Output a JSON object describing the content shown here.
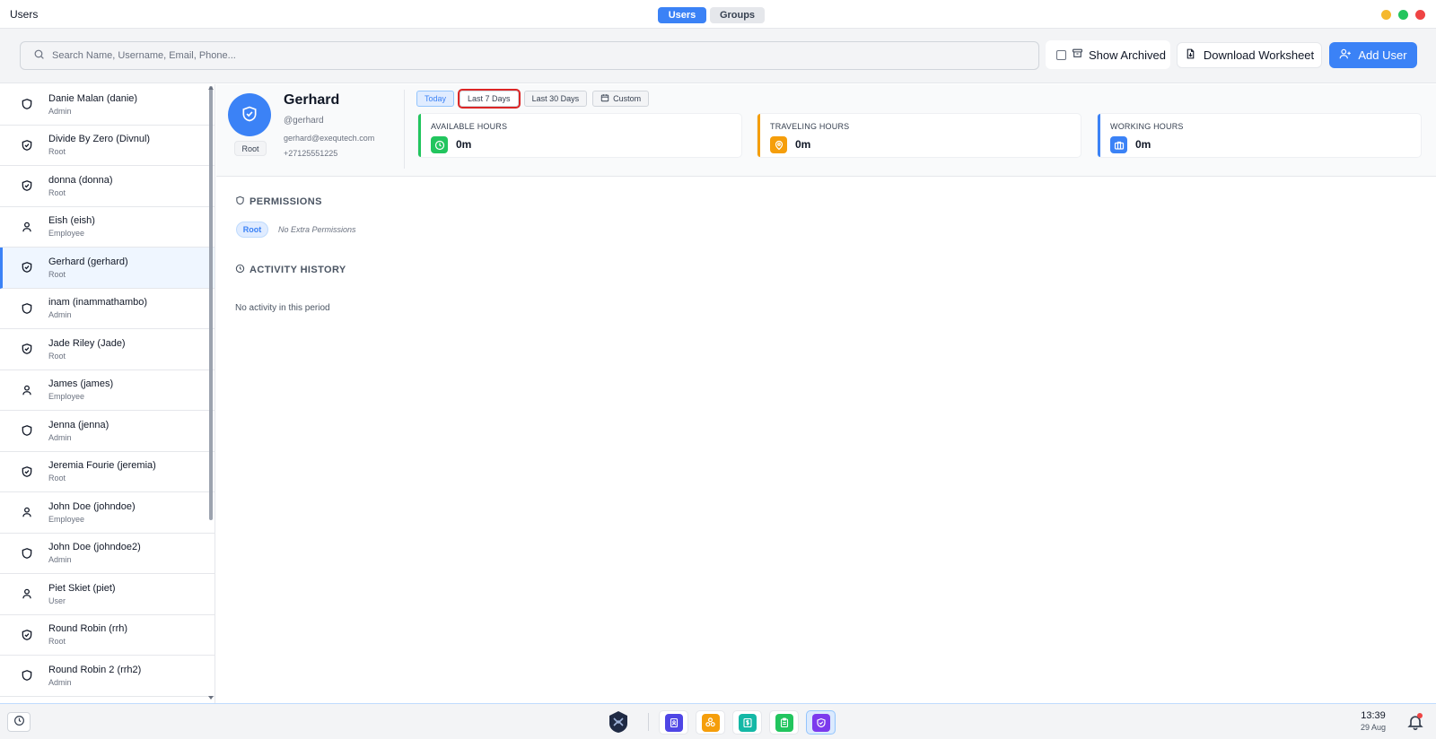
{
  "window": {
    "title": "Users"
  },
  "nav": {
    "users_label": "Users",
    "groups_label": "Groups"
  },
  "colors": {
    "accent": "#3b82f6",
    "available": "#22c55e",
    "traveling": "#f59e0b",
    "working": "#3b82f6",
    "selected_bg": "#eff6ff",
    "highlight_outline": "#dc2626"
  },
  "toolbar": {
    "search_placeholder": "Search Name, Username, Email, Phone...",
    "show_archived_label": "Show Archived",
    "download_label": "Download Worksheet",
    "add_user_label": "Add User"
  },
  "users": [
    {
      "name": "Danie Malan (danie)",
      "role": "Admin",
      "icon": "shield-icon"
    },
    {
      "name": "Divide By Zero (Divnul)",
      "role": "Root",
      "icon": "shield-check-icon"
    },
    {
      "name": "donna (donna)",
      "role": "Root",
      "icon": "shield-check-icon"
    },
    {
      "name": "Eish (eish)",
      "role": "Employee",
      "icon": "user-icon"
    },
    {
      "name": "Gerhard (gerhard)",
      "role": "Root",
      "icon": "shield-check-icon",
      "selected": true
    },
    {
      "name": "inam (inammathambo)",
      "role": "Admin",
      "icon": "shield-icon"
    },
    {
      "name": "Jade Riley (Jade)",
      "role": "Root",
      "icon": "shield-check-icon"
    },
    {
      "name": "James (james)",
      "role": "Employee",
      "icon": "user-icon"
    },
    {
      "name": "Jenna (jenna)",
      "role": "Admin",
      "icon": "shield-icon"
    },
    {
      "name": "Jeremia Fourie (jeremia)",
      "role": "Root",
      "icon": "shield-check-icon"
    },
    {
      "name": "John Doe (johndoe)",
      "role": "Employee",
      "icon": "user-icon"
    },
    {
      "name": "John Doe (johndoe2)",
      "role": "Admin",
      "icon": "shield-icon"
    },
    {
      "name": "Piet Skiet (piet)",
      "role": "User",
      "icon": "user-icon"
    },
    {
      "name": "Round Robin (rrh)",
      "role": "Root",
      "icon": "shield-check-icon"
    },
    {
      "name": "Round Robin 2 (rrh2)",
      "role": "Admin",
      "icon": "shield-icon"
    }
  ],
  "profile": {
    "name": "Gerhard",
    "username": "@gerhard",
    "email": "gerhard@exequtech.com",
    "phone": "+27125551225",
    "role_chip": "Root",
    "avatar_icon": "shield-check-icon"
  },
  "ranges": [
    {
      "label": "Today",
      "state": "active"
    },
    {
      "label": "Last 7 Days",
      "state": "highlight"
    },
    {
      "label": "Last 30 Days",
      "state": "normal"
    },
    {
      "label": "Custom",
      "state": "normal",
      "icon": "calendar-icon"
    }
  ],
  "stats": [
    {
      "label": "AVAILABLE HOURS",
      "value": "0m",
      "icon": "clock-icon"
    },
    {
      "label": "TRAVELING HOURS",
      "value": "0m",
      "icon": "map-pin-icon"
    },
    {
      "label": "WORKING HOURS",
      "value": "0m",
      "icon": "briefcase-icon"
    }
  ],
  "permissions": {
    "title": "PERMISSIONS",
    "chip": "Root",
    "note": "No Extra Permissions"
  },
  "activity": {
    "title": "ACTIVITY HISTORY",
    "empty": "No activity in this period"
  },
  "taskbar": {
    "time": "13:39",
    "date": "29 Aug",
    "apps": [
      "contacts-app-icon",
      "groups-app-icon",
      "billing-app-icon",
      "clipboard-app-icon",
      "users-security-app-icon"
    ]
  }
}
